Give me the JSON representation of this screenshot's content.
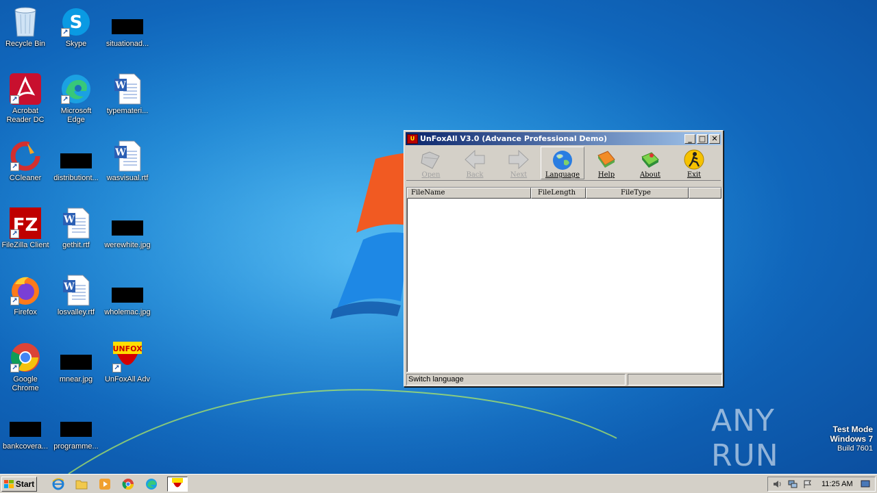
{
  "desktop": {
    "icons": [
      {
        "label": "Recycle Bin",
        "icon": "recycle-bin-icon"
      },
      {
        "label": "Skype",
        "icon": "skype-icon"
      },
      {
        "label": "situationad...",
        "icon": "image-thumbnail-icon"
      },
      {
        "label": "Acrobat Reader DC",
        "icon": "acrobat-icon"
      },
      {
        "label": "Microsoft Edge",
        "icon": "edge-icon"
      },
      {
        "label": "typemateri...",
        "icon": "word-document-icon"
      },
      {
        "label": "CCleaner",
        "icon": "ccleaner-icon"
      },
      {
        "label": "distributiont...",
        "icon": "image-thumbnail-icon"
      },
      {
        "label": "wasvisual.rtf",
        "icon": "word-document-icon"
      },
      {
        "label": "FileZilla Client",
        "icon": "filezilla-icon"
      },
      {
        "label": "gethit.rtf",
        "icon": "word-document-icon"
      },
      {
        "label": "werewhite.jpg",
        "icon": "image-thumbnail-icon"
      },
      {
        "label": "Firefox",
        "icon": "firefox-icon"
      },
      {
        "label": "losvalley.rtf",
        "icon": "word-document-icon"
      },
      {
        "label": "wholemac.jpg",
        "icon": "image-thumbnail-icon"
      },
      {
        "label": "Google Chrome",
        "icon": "chrome-icon"
      },
      {
        "label": "mnear.jpg",
        "icon": "image-thumbnail-icon"
      },
      {
        "label": "UnFoxAll Adv",
        "icon": "unfox-icon"
      },
      {
        "label": "bankcovera...",
        "icon": "image-thumbnail-icon"
      },
      {
        "label": "programme...",
        "icon": "image-thumbnail-icon"
      }
    ]
  },
  "window": {
    "title": "UnFoxAll V3.0 (Advance Professional Demo)",
    "controls": {
      "minimize": "_",
      "maximize": "□",
      "close": "✕"
    },
    "toolbar": [
      {
        "label": "Open",
        "icon": "open-folder-icon",
        "enabled": false
      },
      {
        "label": "Back",
        "icon": "back-arrow-icon",
        "enabled": false
      },
      {
        "label": "Next",
        "icon": "next-arrow-icon",
        "enabled": false
      },
      {
        "label": "Language",
        "icon": "globe-icon",
        "enabled": true
      },
      {
        "label": "Help",
        "icon": "help-book-icon",
        "enabled": true
      },
      {
        "label": "About",
        "icon": "about-book-icon",
        "enabled": true
      },
      {
        "label": "Exit",
        "icon": "exit-icon",
        "enabled": true
      }
    ],
    "list": {
      "columns": [
        "FileName",
        "FileLength",
        "FileType"
      ],
      "rows": []
    },
    "status": {
      "message": "Switch language",
      "secondary": ""
    }
  },
  "taskbar": {
    "start_label": "Start",
    "quick_launch": [
      "internet-explorer-icon",
      "folder-icon",
      "media-player-icon",
      "chrome-icon",
      "edge-icon",
      "unfox-icon"
    ],
    "clock": "11:25 AM"
  },
  "watermark": {
    "line1": "Test Mode",
    "line2": "Windows 7",
    "line3": "Build 7601",
    "brand": "ANY RUN"
  }
}
